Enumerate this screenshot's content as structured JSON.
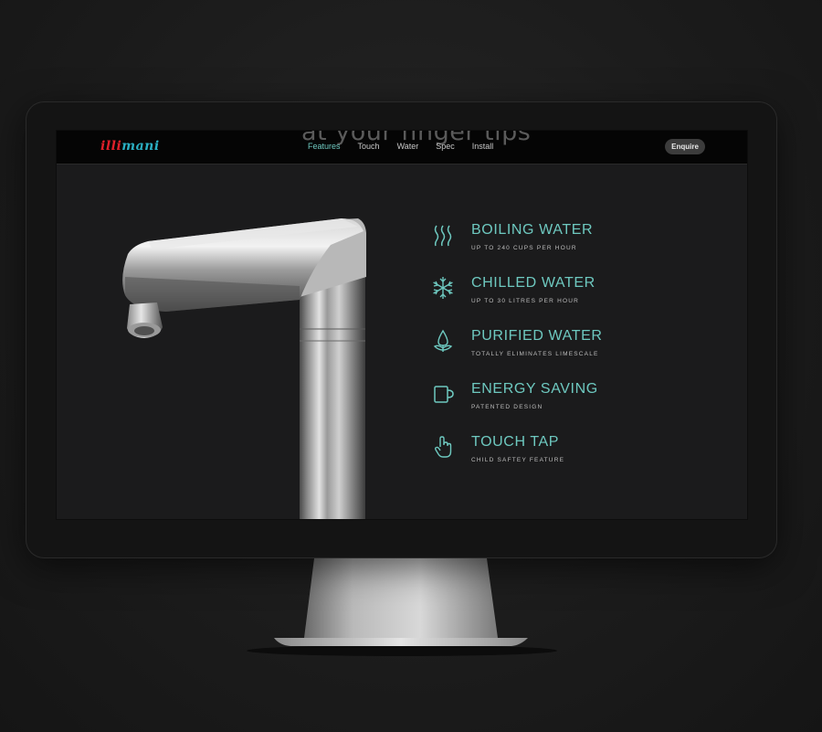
{
  "website": {
    "logo": {
      "part1": "illi",
      "part2": "mani"
    },
    "ghost_heading": "at your finger tips",
    "nav": [
      {
        "label": "Features",
        "active": true
      },
      {
        "label": "Touch",
        "active": false
      },
      {
        "label": "Water",
        "active": false
      },
      {
        "label": "Spec",
        "active": false
      },
      {
        "label": "Install",
        "active": false
      }
    ],
    "enquire_label": "Enquire",
    "features": [
      {
        "icon": "steam-icon",
        "title": "BOILING WATER",
        "subtitle": "UP TO 240 CUPS PER HOUR"
      },
      {
        "icon": "snowflake-icon",
        "title": "CHILLED WATER",
        "subtitle": "UP TO 30 LITRES PER HOUR"
      },
      {
        "icon": "water-drop-icon",
        "title": "PURIFIED WATER",
        "subtitle": "TOTALLY ELIMINATES LIMESCALE"
      },
      {
        "icon": "mug-icon",
        "title": "ENERGY SAVING",
        "subtitle": "PATENTED DESIGN"
      },
      {
        "icon": "touch-hand-icon",
        "title": "TOUCH TAP",
        "subtitle": "CHILD SAFTEY FEATURE"
      }
    ]
  },
  "colors": {
    "accent": "#6ec9c0",
    "logo_red": "#e0202a",
    "logo_blue": "#2bb0c4",
    "background": "#1b1b1c"
  }
}
